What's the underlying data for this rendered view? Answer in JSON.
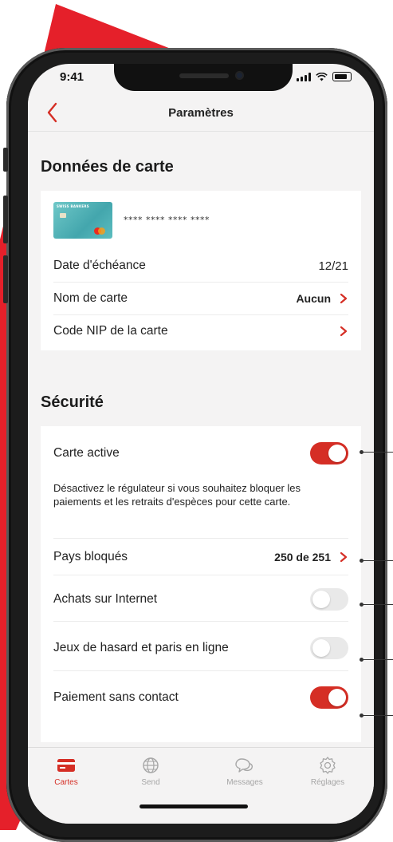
{
  "status_bar": {
    "time": "9:41"
  },
  "header": {
    "title": "Paramètres"
  },
  "card_section": {
    "title": "Données de carte",
    "card_number_masked": "**** **** **** ****",
    "card_brand_text": "SWISS BANKERS",
    "rows": [
      {
        "label": "Date d'échéance",
        "value": "12/21"
      },
      {
        "label": "Nom de carte",
        "value": "Aucun"
      },
      {
        "label": "Code NIP de la carte",
        "value": ""
      }
    ]
  },
  "security_section": {
    "title": "Sécurité",
    "active_card": {
      "label": "Carte active",
      "enabled": true
    },
    "description": "Désactivez le régulateur si vous souhaitez bloquer les paiements et les retraits d'espèces pour cette carte.",
    "blocked_countries": {
      "label": "Pays bloqués",
      "value": "250 de 251"
    },
    "internet_purchases": {
      "label": "Achats sur Internet",
      "enabled": false
    },
    "gambling": {
      "label": "Jeux de hasard et paris en ligne",
      "enabled": false
    },
    "contactless": {
      "label": "Paiement sans contact",
      "enabled": true
    }
  },
  "tabbar": {
    "tabs": [
      {
        "label": "Cartes",
        "icon": "card-icon",
        "active": true
      },
      {
        "label": "Send",
        "icon": "globe-icon",
        "active": false
      },
      {
        "label": "Messages",
        "icon": "chat-bubbles-icon",
        "active": false
      },
      {
        "label": "Réglages",
        "icon": "gear-icon",
        "active": false
      }
    ]
  },
  "colors": {
    "accent": "#d52e25",
    "background": "#f4f3f3",
    "surface": "#ffffff",
    "toggle_off": "#e9e9e9"
  }
}
